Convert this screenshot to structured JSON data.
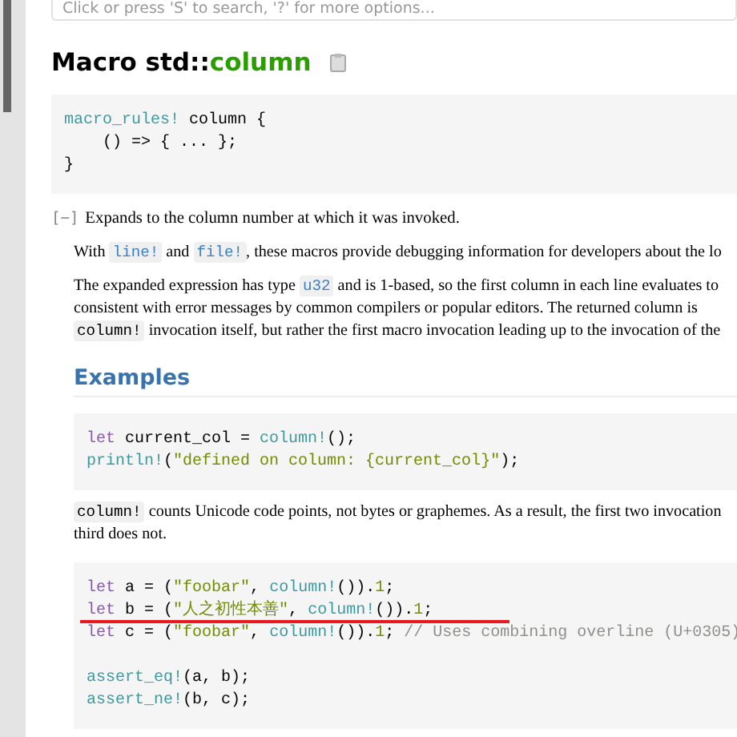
{
  "search": {
    "placeholder": "Click or press 'S' to search, '?' for more options..."
  },
  "title": {
    "prefix": "Macro std::",
    "name": "column"
  },
  "signature": [
    [
      {
        "kind": "mac",
        "text": "macro_rules!"
      },
      {
        "kind": "plain",
        "text": " column {"
      }
    ],
    [
      {
        "kind": "plain",
        "text": "    () => { ... };"
      }
    ],
    [
      {
        "kind": "plain",
        "text": "}"
      }
    ]
  ],
  "toggle": "[−]",
  "summary": "Expands to the column number at which it was invoked.",
  "paragraphs": [
    [
      [
        {
          "kind": "text",
          "text": "With "
        },
        {
          "kind": "code",
          "text": "line!"
        },
        {
          "kind": "text",
          "text": " and "
        },
        {
          "kind": "code",
          "text": "file!"
        },
        {
          "kind": "text",
          "text": ", these macros provide debugging information for developers about the lo"
        }
      ]
    ],
    [
      [
        {
          "kind": "text",
          "text": "The expanded expression has type "
        },
        {
          "kind": "code",
          "text": "u32"
        },
        {
          "kind": "text",
          "text": " and is 1-based, so the first column in each line evaluates to"
        }
      ],
      [
        {
          "kind": "text",
          "text": "consistent with error messages by common compilers or popular editors. The returned column is"
        }
      ],
      [
        {
          "kind": "code",
          "text": "column!"
        },
        {
          "kind": "text",
          "text": " invocation itself, but rather the first macro invocation leading up to the invocation of the"
        }
      ]
    ]
  ],
  "examples_heading": "Examples",
  "example1": [
    [
      {
        "kind": "kw",
        "text": "let"
      },
      {
        "kind": "plain",
        "text": " current_col = "
      },
      {
        "kind": "mac",
        "text": "column!"
      },
      {
        "kind": "plain",
        "text": "();"
      }
    ],
    [
      {
        "kind": "mac",
        "text": "println!"
      },
      {
        "kind": "plain",
        "text": "("
      },
      {
        "kind": "str",
        "text": "\"defined on column: {current_col}\""
      },
      {
        "kind": "plain",
        "text": ");"
      }
    ]
  ],
  "paragraph_after": [
    [
      {
        "kind": "code",
        "text": "column!"
      },
      {
        "kind": "text",
        "text": " counts Unicode code points, not bytes or graphemes. As a result, the first two invocation"
      }
    ],
    [
      {
        "kind": "text",
        "text": "third does not."
      }
    ]
  ],
  "example2": [
    [
      {
        "underlined": false,
        "tokens": [
          {
            "kind": "kw",
            "text": "let"
          },
          {
            "kind": "plain",
            "text": " a = ("
          },
          {
            "kind": "str",
            "text": "\"foobar\""
          },
          {
            "kind": "plain",
            "text": ", "
          },
          {
            "kind": "mac",
            "text": "column!"
          },
          {
            "kind": "plain",
            "text": "())."
          },
          {
            "kind": "num",
            "text": "1"
          },
          {
            "kind": "plain",
            "text": ";"
          }
        ]
      },
      {
        "underlined": true,
        "tokens": [
          {
            "kind": "kw",
            "text": "let"
          },
          {
            "kind": "plain",
            "text": " b = ("
          },
          {
            "kind": "str",
            "text": "\"人之初性本善\""
          },
          {
            "kind": "plain",
            "text": ", "
          },
          {
            "kind": "mac",
            "text": "column!"
          },
          {
            "kind": "plain",
            "text": "())."
          },
          {
            "kind": "num",
            "text": "1"
          },
          {
            "kind": "plain",
            "text": ";"
          }
        ]
      },
      {
        "underlined": false,
        "tokens": [
          {
            "kind": "kw",
            "text": "let"
          },
          {
            "kind": "plain",
            "text": " c = ("
          },
          {
            "kind": "str",
            "text": "\"foobar\""
          },
          {
            "kind": "plain",
            "text": ", "
          },
          {
            "kind": "mac",
            "text": "column!"
          },
          {
            "kind": "plain",
            "text": "())."
          },
          {
            "kind": "num",
            "text": "1"
          },
          {
            "kind": "plain",
            "text": "; "
          },
          {
            "kind": "comment",
            "text": "// Uses combining overline (U+0305)"
          }
        ]
      }
    ],
    [
      {
        "underlined": false,
        "tokens": [
          {
            "kind": "mac",
            "text": "assert_eq!"
          },
          {
            "kind": "plain",
            "text": "(a, b);"
          }
        ]
      },
      {
        "underlined": false,
        "tokens": [
          {
            "kind": "mac",
            "text": "assert_ne!"
          },
          {
            "kind": "plain",
            "text": "(b, c);"
          }
        ]
      }
    ]
  ]
}
